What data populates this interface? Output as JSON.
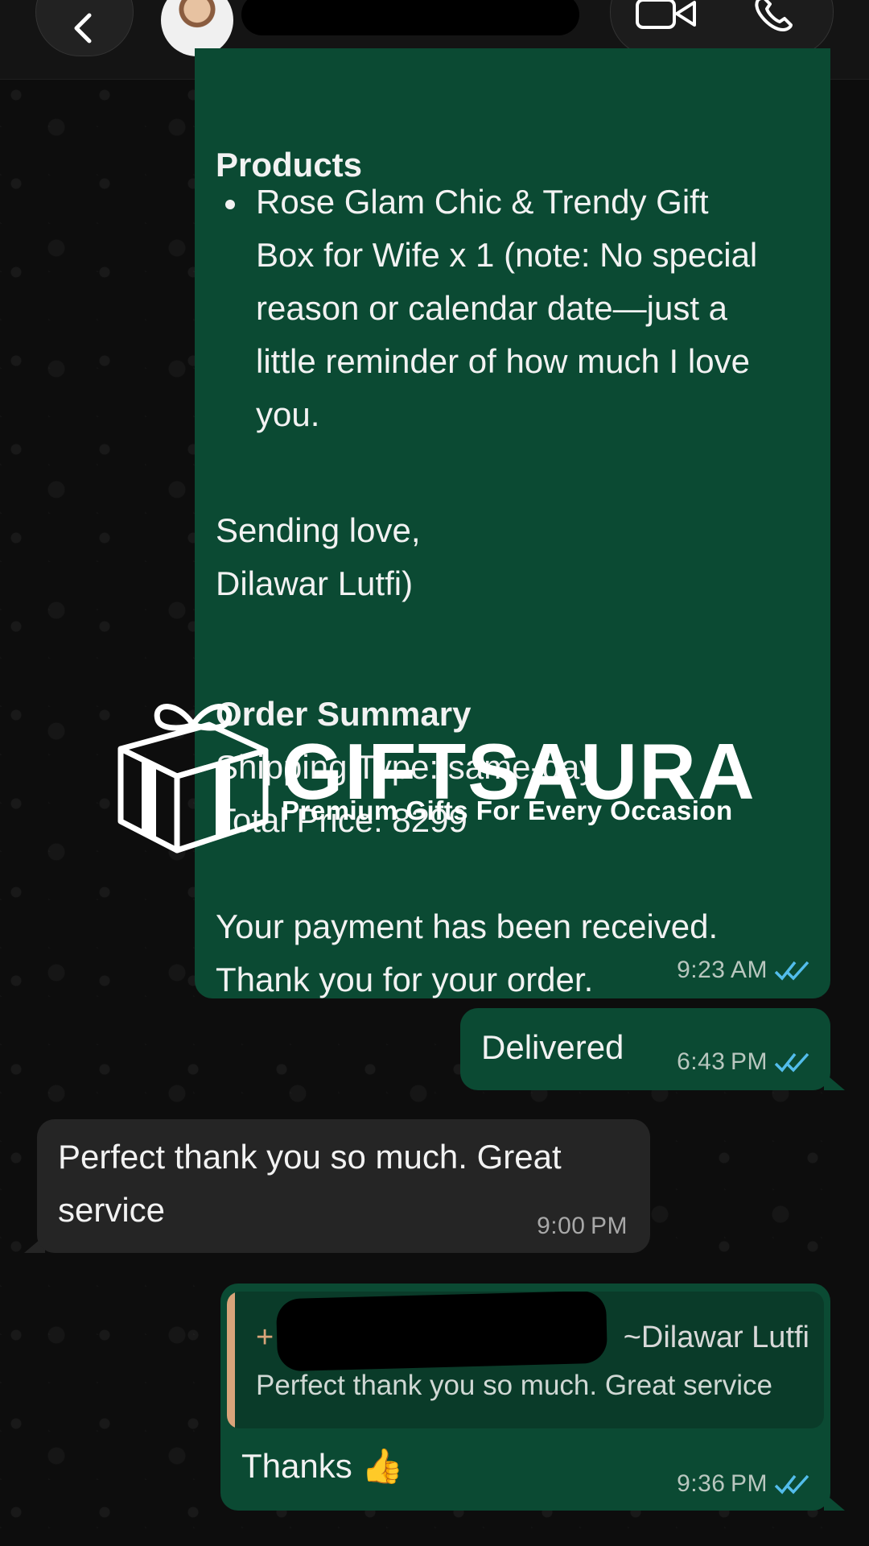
{
  "header": {
    "back_icon": "chevron-left-icon",
    "video_call_icon": "video-camera-icon",
    "voice_call_icon": "phone-icon"
  },
  "messages": {
    "order": {
      "products_heading": "Products",
      "bullet_lines": [
        "Rose Glam Chic & Trendy Gift",
        "Box for Wife x 1 (note: No special",
        "reason or calendar date—just a",
        "little reminder of how much I love",
        "you."
      ],
      "closing_lines": [
        "Sending love,",
        "Dilawar Lutfi)"
      ],
      "summary_heading": "Order Summary",
      "summary_lines": [
        "Shipping Type: same-day",
        "Total Price: 8299"
      ],
      "payment_lines": [
        "Your payment has been received.",
        "Thank you for your order."
      ],
      "time": "9:23 AM"
    },
    "delivered": {
      "text": "Delivered",
      "time": "6:43 PM"
    },
    "incoming": {
      "lines": [
        "Perfect thank you so much. Great",
        "service"
      ],
      "time": "9:00 PM"
    },
    "reply": {
      "quote_plus": "+",
      "quote_author": "~Dilawar Lutfi",
      "quote_text": "Perfect thank you so much. Great service",
      "text": "Thanks 👍",
      "time": "9:36 PM"
    }
  },
  "watermark": {
    "brand": "GIFTSAURA",
    "tagline": "Premium Gifts For Every Occasion"
  },
  "colors": {
    "outgoing_bubble": "#0b4a33",
    "incoming_bubble": "#252525",
    "read_ticks": "#53bdeb",
    "quote_bar": "#d9a47a"
  }
}
